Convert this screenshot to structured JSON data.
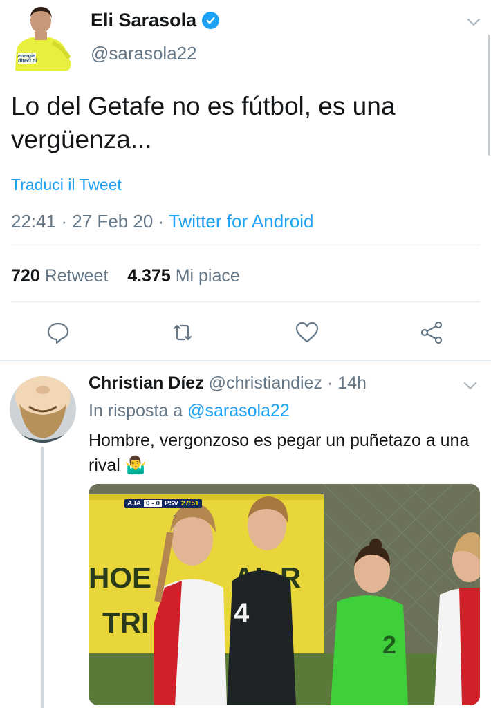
{
  "main_tweet": {
    "display_name": "Eli Sarasola",
    "handle": "@sarasola22",
    "avatar_shirt_text": "energie direct.nl",
    "text": "Lo del Getafe no es fútbol, es una vergüenza...",
    "translate_label": "Traduci il Tweet",
    "time": "22:41",
    "date": "27 Feb 20",
    "separator": "·",
    "source": "Twitter for Android",
    "retweet_count": "720",
    "retweet_label": "Retweet",
    "like_count": "4.375",
    "like_label": "Mi piace",
    "actions": [
      "reply-icon",
      "retweet-icon",
      "like-icon",
      "share-icon"
    ],
    "accent_color": "#1da1f2"
  },
  "reply": {
    "display_name": "Christian Díez",
    "handle": "@christiandiez",
    "separator": "·",
    "age": "14h",
    "in_reply_to_label": "In risposta a",
    "in_reply_to_handle": "@sarasola22",
    "text": "Hombre, vergonzoso es pegar un puñetazo a una rival",
    "emoji": "🤷‍♂️",
    "media": {
      "scoreboard": {
        "home": "AJA",
        "score": "0 - 0",
        "away": "PSV",
        "clock": "27:51"
      }
    }
  }
}
